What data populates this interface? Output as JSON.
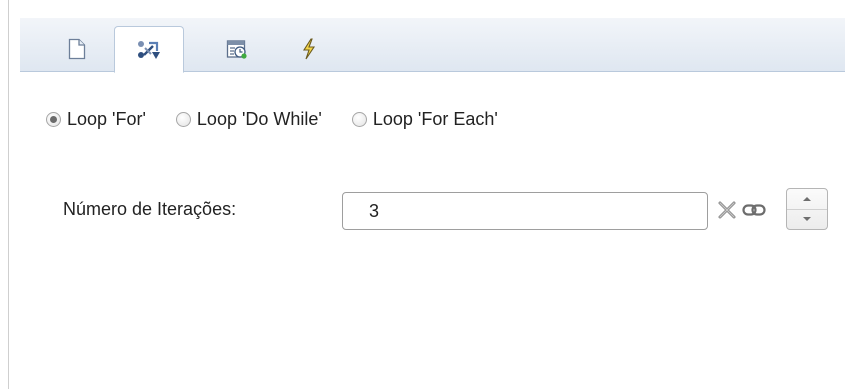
{
  "tabs": [
    {
      "icon": "document-icon",
      "active": false
    },
    {
      "icon": "loop-tool-icon",
      "active": true
    },
    {
      "icon": "schedule-calendar-icon",
      "active": false
    },
    {
      "icon": "lightning-icon",
      "active": false
    }
  ],
  "loop_options": {
    "for_label": "Loop 'For'",
    "do_while_label": "Loop 'Do While'",
    "for_each_label": "Loop 'For Each'",
    "selected": "for"
  },
  "iterations": {
    "label": "Número de Iterações:",
    "value": "3"
  },
  "colors": {
    "tabbar_top": "#f2f5f9",
    "tabbar_bottom": "#dfe7f1",
    "border": "#b9c9dc"
  }
}
